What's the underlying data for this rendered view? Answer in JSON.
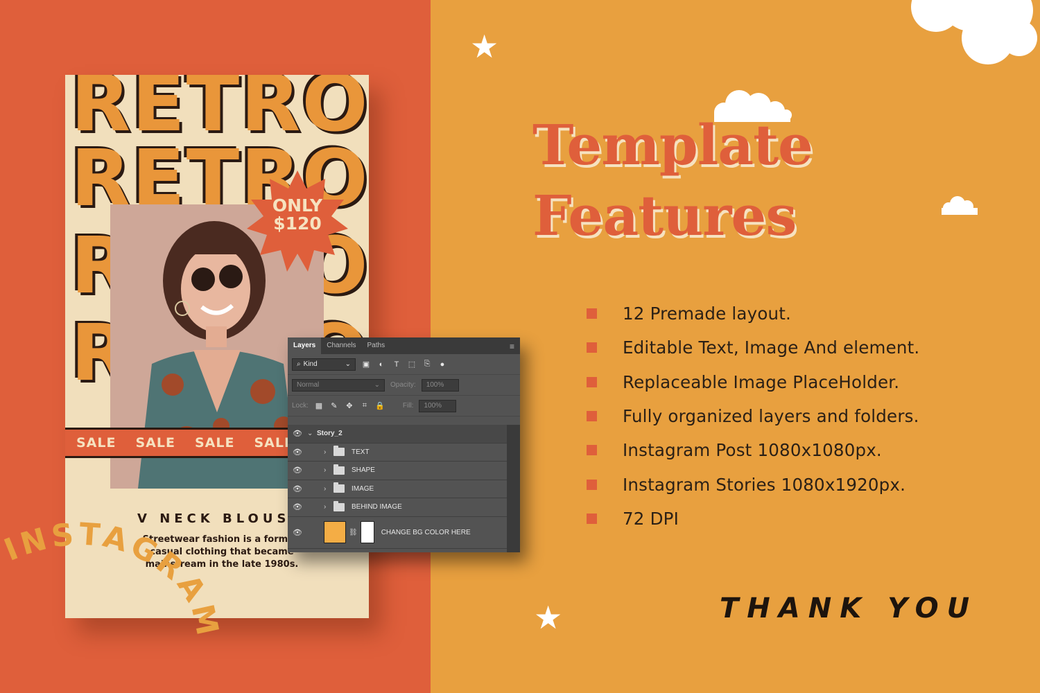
{
  "colors": {
    "left_bg": "#df5f3b",
    "right_bg": "#e8a03f",
    "accent": "#df5f3b",
    "cream": "#f1dfbc",
    "dark": "#2b1a12"
  },
  "story": {
    "retro_words": [
      "RETRO",
      "RETRO",
      "RETRO",
      "RETRO"
    ],
    "badge": {
      "line1": "ONLY",
      "line2": "$120"
    },
    "sale_items": [
      "SALE",
      "SALE",
      "SALE",
      "SALE"
    ],
    "product_title": "V NECK BLOUS",
    "product_desc": "Streetwear fashion is a form of casual clothing that became mainstream in the late 1980s."
  },
  "instagram_label": "INSTAGRAM",
  "layers_panel": {
    "tabs": [
      "Layers",
      "Channels",
      "Paths"
    ],
    "filter_kind": "Kind",
    "blend_mode": "Normal",
    "opacity_label": "Opacity:",
    "opacity_value": "100%",
    "lock_label": "Lock:",
    "fill_label": "Fill:",
    "fill_value": "100%",
    "group_name": "Story_2",
    "folders": [
      "TEXT",
      "SHAPE",
      "IMAGE",
      "BEHIND IMAGE"
    ],
    "bg_layer_name": "CHANGE BG COLOR HERE",
    "icons": [
      "eye-icon",
      "folder-icon",
      "search-icon",
      "menu-icon",
      "lock-icon"
    ]
  },
  "headline": {
    "line1": "Template",
    "line2": "Features"
  },
  "features": [
    "12 Premade layout.",
    "Editable Text, Image And element.",
    "Replaceable Image PlaceHolder.",
    "Fully organized layers and folders.",
    "Instagram Post 1080x1080px.",
    "Instagram Stories 1080x1920px.",
    "72 DPI"
  ],
  "thanks": "THANK YOU"
}
